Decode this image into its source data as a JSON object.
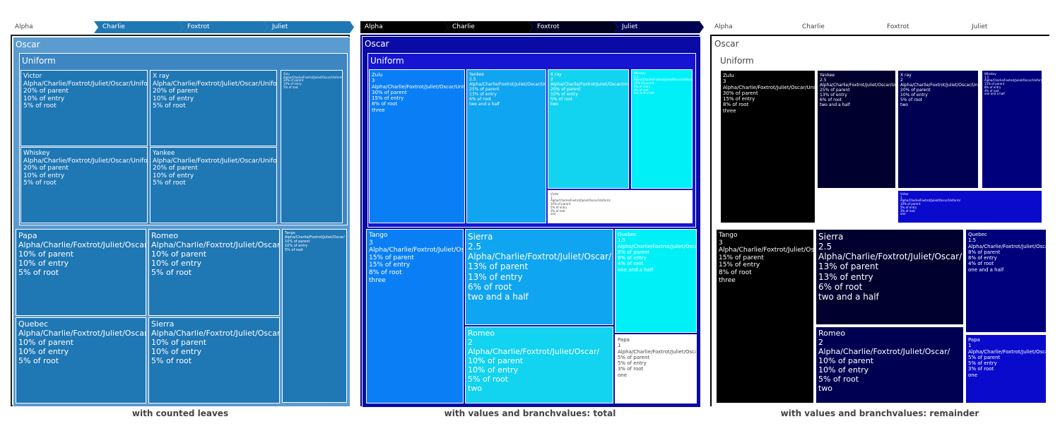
{
  "chart_data": [
    {
      "type": "treemap",
      "title": "with counted leaves",
      "branchvalues": "counted leaves",
      "pathbar": [
        "Alpha",
        "Charlie",
        "Foxtrot",
        "Juliet"
      ],
      "colors": {
        "fill": "#1f77b4",
        "pathbar": "#1f77b4",
        "border": "#ffffff",
        "frame": "#222222",
        "text": "#ffffff"
      },
      "nodes": [
        {
          "id": "oscar",
          "label": "Oscar",
          "lines": []
        },
        {
          "id": "uniform",
          "label": "Uniform",
          "lines": []
        },
        {
          "id": "victor",
          "label": "Victor",
          "lines": [
            "Alpha/Charlie/Foxtrot/Juliet/Oscar/Uniform/",
            "20% of parent",
            "10% of entry",
            "5% of root"
          ]
        },
        {
          "id": "xray",
          "label": "X ray",
          "lines": [
            "Alpha/Charlie/Foxtrot/Juliet/Oscar/Uniform/",
            "20% of parent",
            "10% of entry",
            "5% of root"
          ]
        },
        {
          "id": "zulu",
          "label": "Zulu",
          "lines": [
            "Alpha/Charlie/Foxtrot/Juliet/Oscar/Uniform/",
            "20% of parent",
            "10% of entry",
            "5% of root"
          ]
        },
        {
          "id": "whiskey",
          "label": "Whiskey",
          "lines": [
            "Alpha/Charlie/Foxtrot/Juliet/Oscar/Uniform/",
            "20% of parent",
            "10% of entry",
            "5% of root"
          ]
        },
        {
          "id": "yankee",
          "label": "Yankee",
          "lines": [
            "Alpha/Charlie/Foxtrot/Juliet/Oscar/Uniform/",
            "20% of parent",
            "10% of entry",
            "5% of root"
          ]
        },
        {
          "id": "papa",
          "label": "Papa",
          "lines": [
            "Alpha/Charlie/Foxtrot/Juliet/Oscar/",
            "10% of parent",
            "10% of entry",
            "5% of root"
          ]
        },
        {
          "id": "romeo",
          "label": "Romeo",
          "lines": [
            "Alpha/Charlie/Foxtrot/Juliet/Oscar/",
            "10% of parent",
            "10% of entry",
            "5% of root"
          ]
        },
        {
          "id": "tango",
          "label": "Tango",
          "lines": [
            "Alpha/Charlie/Foxtrot/Juliet/Oscar/",
            "10% of parent",
            "10% of entry",
            "5% of root"
          ]
        },
        {
          "id": "quebec",
          "label": "Quebec",
          "lines": [
            "Alpha/Charlie/Foxtrot/Juliet/Oscar/",
            "10% of parent",
            "10% of entry",
            "5% of root"
          ]
        },
        {
          "id": "sierra",
          "label": "Sierra",
          "lines": [
            "Alpha/Charlie/Foxtrot/Juliet/Oscar/",
            "10% of parent",
            "10% of entry",
            "5% of root"
          ]
        }
      ]
    },
    {
      "type": "treemap",
      "title": "with values and branchvalues: total",
      "branchvalues": "total",
      "pathbar": [
        "Alpha",
        "Charlie",
        "Foxtrot",
        "Juliet"
      ],
      "colors": {
        "pathbar": "#000000",
        "frame": "#000080",
        "border": "#ffffff"
      },
      "nodes": [
        {
          "id": "oscar",
          "label": "Oscar",
          "lines": [],
          "color": "#0a0aa6"
        },
        {
          "id": "uniform",
          "label": "Uniform",
          "lines": [],
          "color": "#1515d2"
        },
        {
          "id": "zulu",
          "label": "Zulu",
          "lines": [
            "3",
            "Alpha/Charlie/Foxtrot/Juliet/Oscar/Uniform/",
            "30% of parent",
            "15% of entry",
            "8% of root",
            "three"
          ],
          "color": "#0a7ff5"
        },
        {
          "id": "yankee",
          "label": "Yankee",
          "lines": [
            "2.5",
            "Alpha/Charlie/Foxtrot/Juliet/Oscar/Uniform/",
            "25% of parent",
            "13% of entry",
            "6% of root",
            "two and a half"
          ],
          "color": "#10a5f0"
        },
        {
          "id": "xray",
          "label": "X ray",
          "lines": [
            "2",
            "Alpha/Charlie/Foxtrot/Juliet/Oscar/Uniform/",
            "20% of parent",
            "10% of entry",
            "5% of root",
            "two"
          ],
          "color": "#12d3f0"
        },
        {
          "id": "whiskey",
          "label": "Whiskey",
          "lines": [
            "1.5",
            "Alpha/Charlie/Foxtrot/Juliet/Oscar/Uniform/",
            "15% of parent",
            "8% of entry",
            "4% of root",
            "one and a half"
          ],
          "color": "#00f0f8"
        },
        {
          "id": "victor",
          "label": "Victor",
          "lines": [
            "1",
            "Alpha/Charlie/Foxtrot/Juliet/Oscar/Uniform/",
            "10% of parent",
            "5% of entry",
            "3% of root",
            "one"
          ],
          "color": "#ffffff"
        },
        {
          "id": "tango",
          "label": "Tango",
          "lines": [
            "3",
            "Alpha/Charlie/Foxtrot/Juliet/Oscar/",
            "15% of parent",
            "15% of entry",
            "8% of root",
            "three"
          ],
          "color": "#0a7ff5"
        },
        {
          "id": "sierra",
          "label": "Sierra",
          "lines": [
            "2.5",
            "Alpha/Charlie/Foxtrot/Juliet/Oscar/",
            "13% of parent",
            "13% of entry",
            "6% of root",
            "two and a half"
          ],
          "color": "#10a5f0"
        },
        {
          "id": "romeo",
          "label": "Romeo",
          "lines": [
            "2",
            "Alpha/Charlie/Foxtrot/Juliet/Oscar/",
            "10% of parent",
            "10% of entry",
            "5% of root",
            "two"
          ],
          "color": "#12d3f0"
        },
        {
          "id": "quebec",
          "label": "Quebec",
          "lines": [
            "1.5",
            "Alpha/Charlie/Foxtrot/Juliet/Oscar/",
            "8% of parent",
            "8% of entry",
            "4% of root",
            "one and a half"
          ],
          "color": "#00f0f8"
        },
        {
          "id": "papa",
          "label": "Papa",
          "lines": [
            "1",
            "Alpha/Charlie/Foxtrot/Juliet/Oscar/",
            "5% of parent",
            "5% of entry",
            "3% of root",
            "one"
          ],
          "color": "#ffffff"
        }
      ]
    },
    {
      "type": "treemap",
      "title": "with values and branchvalues: remainder",
      "branchvalues": "remainder",
      "pathbar": [
        "Alpha",
        "Charlie",
        "Foxtrot",
        "Juliet"
      ],
      "colors": {
        "pathbar": "#ffffff",
        "frame": "#000000",
        "border": "#ffffff"
      },
      "nodes": [
        {
          "id": "oscar",
          "label": "Oscar",
          "lines": [],
          "color": "#ffffff"
        },
        {
          "id": "uniform",
          "label": "Uniform",
          "lines": [],
          "color": "#ffffff"
        },
        {
          "id": "zulu",
          "label": "Zulu",
          "lines": [
            "3",
            "Alpha/Charlie/Foxtrot/Juliet/Oscar/Uniform/",
            "30% of parent",
            "15% of entry",
            "8% of root",
            "three"
          ],
          "color": "#000000"
        },
        {
          "id": "yankee",
          "label": "Yankee",
          "lines": [
            "2.5",
            "Alpha/Charlie/Foxtrot/Juliet/Oscar/Uniform/",
            "25% of parent",
            "13% of entry",
            "6% of root",
            "two and a half"
          ],
          "color": "#00002e"
        },
        {
          "id": "xray",
          "label": "X ray",
          "lines": [
            "2",
            "Alpha/Charlie/Foxtrot/Juliet/Oscar/Uniform/",
            "20% of parent",
            "10% of entry",
            "5% of root",
            "two"
          ],
          "color": "#000052"
        },
        {
          "id": "whiskey",
          "label": "Whiskey",
          "lines": [
            "1.5",
            "Alpha/Charlie/Foxtrot/Juliet/Oscar/Uniform/",
            "15% of parent",
            "8% of entry",
            "4% of root",
            "one and a half"
          ],
          "color": "#00007c"
        },
        {
          "id": "victor",
          "label": "Victor",
          "lines": [
            "1",
            "Alpha/Charlie/Foxtrot/Juliet/Oscar/Uniform/",
            "10% of parent",
            "5% of entry",
            "3% of root",
            "one"
          ],
          "color": "#0a0acd"
        },
        {
          "id": "tango",
          "label": "Tango",
          "lines": [
            "3",
            "Alpha/Charlie/Foxtrot/Juliet/Oscar/",
            "15% of parent",
            "15% of entry",
            "8% of root",
            "three"
          ],
          "color": "#000000"
        },
        {
          "id": "sierra",
          "label": "Sierra",
          "lines": [
            "2.5",
            "Alpha/Charlie/Foxtrot/Juliet/Oscar/",
            "13% of parent",
            "13% of entry",
            "6% of root",
            "two and a half"
          ],
          "color": "#00002e"
        },
        {
          "id": "romeo",
          "label": "Romeo",
          "lines": [
            "2",
            "Alpha/Charlie/Foxtrot/Juliet/Oscar/",
            "10% of parent",
            "10% of entry",
            "5% of root",
            "two"
          ],
          "color": "#000052"
        },
        {
          "id": "quebec",
          "label": "Quebec",
          "lines": [
            "1.5",
            "Alpha/Charlie/Foxtrot/Juliet/Oscar/",
            "8% of parent",
            "8% of entry",
            "4% of root",
            "one and a half"
          ],
          "color": "#00007c"
        },
        {
          "id": "papa",
          "label": "Papa",
          "lines": [
            "1",
            "Alpha/Charlie/Foxtrot/Juliet/Oscar/",
            "5% of parent",
            "5% of entry",
            "3% of root",
            "one"
          ],
          "color": "#0a0acd"
        }
      ]
    }
  ]
}
